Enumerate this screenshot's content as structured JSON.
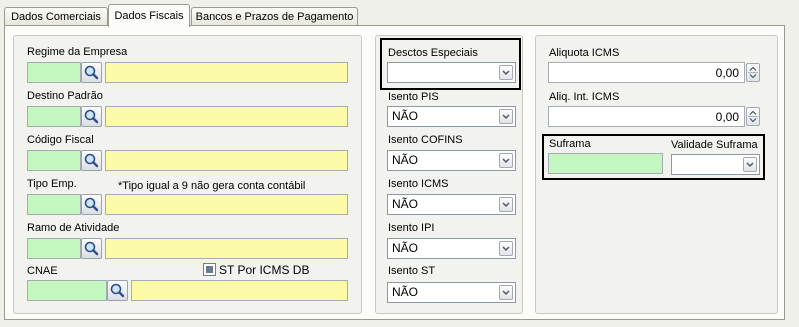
{
  "tabs": [
    {
      "label": "Dados Comerciais"
    },
    {
      "label": "Dados Fiscais"
    },
    {
      "label": "Bancos e Prazos de Pagamento"
    }
  ],
  "active_tab": "Dados Fiscais",
  "left_panel": {
    "regime_label": "Regime da Empresa",
    "destino_label": "Destino Padrão",
    "codigo_fiscal_label": "Código Fiscal",
    "tipo_emp_label": "Tipo Emp.",
    "tipo_emp_note": "*Tipo igual a 9 não gera conta contábil",
    "ramo_label": "Ramo de Atividade",
    "cnae_label": "CNAE",
    "st_checkbox_label": "ST Por ICMS DB",
    "st_checkbox_checked": true
  },
  "mid_panel": {
    "desctos_label": "Desctos Especiais",
    "desctos_value": "",
    "isento_pis_label": "Isento PIS",
    "isento_pis_value": "NÃO",
    "isento_cofins_label": "Isento COFINS",
    "isento_cofins_value": "NÃO",
    "isento_icms_label": "Isento ICMS",
    "isento_icms_value": "NÃO",
    "isento_ipi_label": "Isento IPI",
    "isento_ipi_value": "NÃO",
    "isento_st_label": "Isento ST",
    "isento_st_value": "NÃO"
  },
  "right_panel": {
    "aliquota_label": "Aliquota ICMS",
    "aliquota_value": "0,00",
    "aliq_int_label": "Aliq. Int. ICMS",
    "aliq_int_value": "0,00",
    "suframa_label": "Suframa",
    "suframa_value": "",
    "validade_label": "Validade Suframa",
    "validade_value": ""
  },
  "colors": {
    "field_green": "#c4f7c0",
    "field_yellow": "#fafaa8",
    "highlight_border": "#000000"
  },
  "icons": {
    "lookup": "magnifier-icon",
    "dropdown": "chevron-down-icon",
    "spin": "spin-arrows-icon"
  }
}
